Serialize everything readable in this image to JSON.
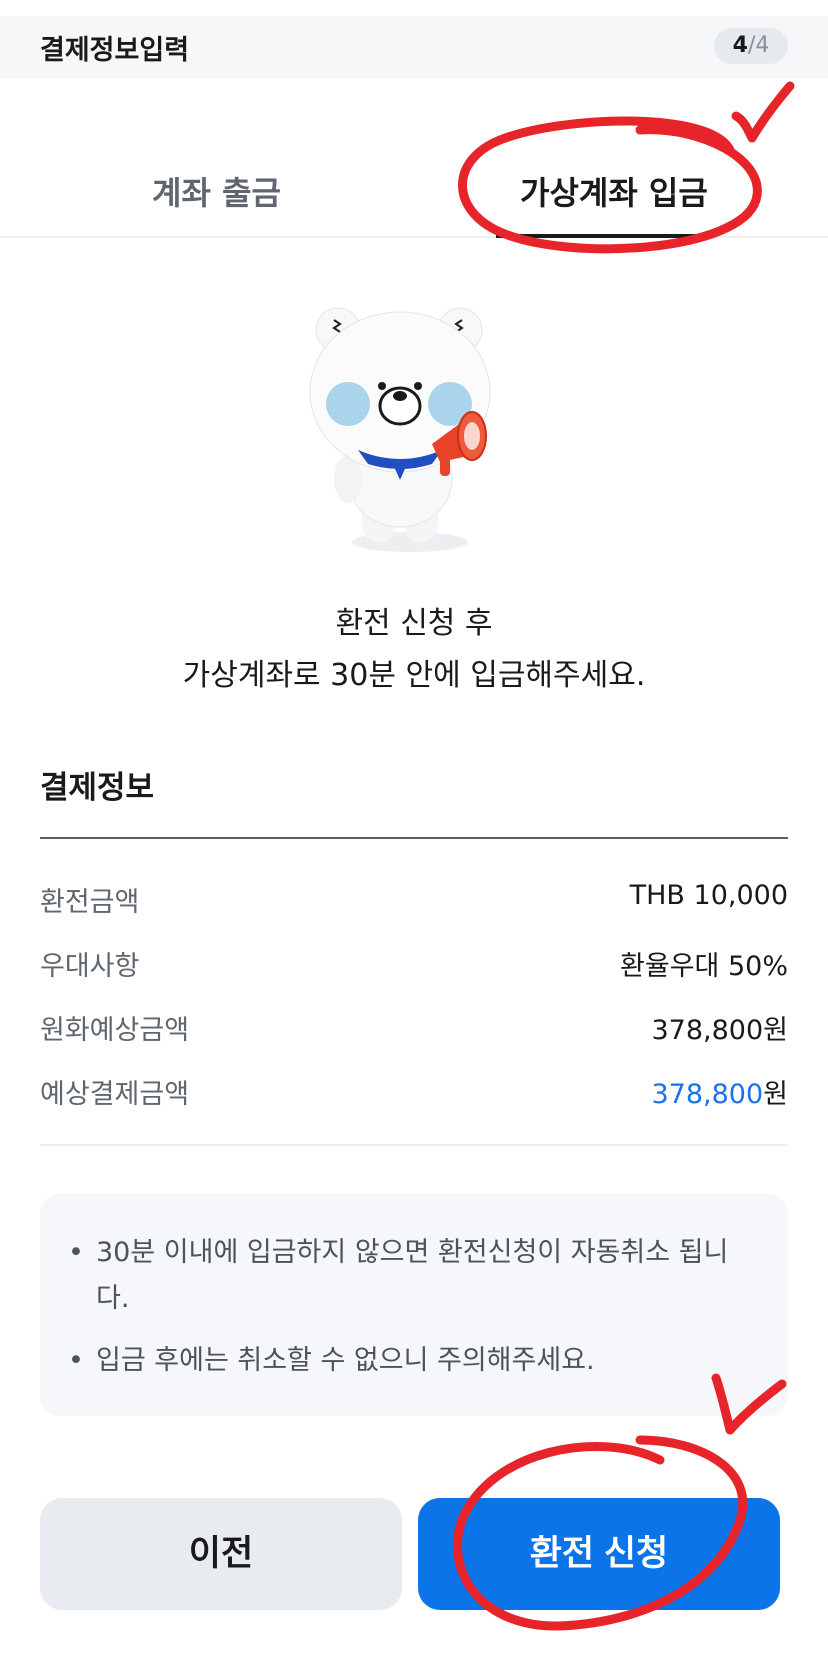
{
  "header": {
    "title": "결제정보입력",
    "step_current": "4",
    "step_separator": "/",
    "step_total": "4"
  },
  "tabs": [
    {
      "label": "계좌 출금",
      "active": false
    },
    {
      "label": "가상계좌 입금",
      "active": true
    }
  ],
  "guide": {
    "line1": "환전 신청 후",
    "line2": "가상계좌로 30분 안에 입금해주세요."
  },
  "payment_info": {
    "title": "결제정보",
    "rows": [
      {
        "label": "환전금액",
        "value": "THB 10,000"
      },
      {
        "label": "우대사항",
        "value": "환율우대 50%"
      },
      {
        "label": "원화예상금액",
        "value": "378,800원"
      },
      {
        "label": "예상결제금액",
        "value_amount": "378,800",
        "value_unit": "원"
      }
    ]
  },
  "notice": [
    "30분 이내에 입금하지 않으면 환전신청이 자동취소 됩니다.",
    "입금 후에는 취소할 수 없으니 주의해주세요."
  ],
  "buttons": {
    "prev": "이전",
    "apply": "환전 신청"
  },
  "colors": {
    "accent": "#0b74e8",
    "annotation": "#e8242b"
  }
}
